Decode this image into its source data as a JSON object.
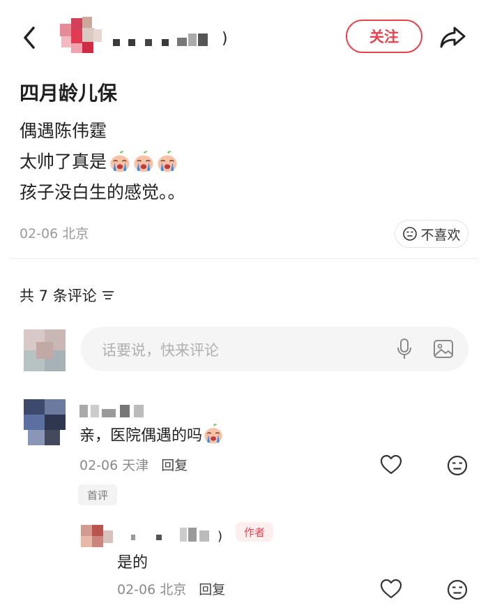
{
  "colors": {
    "accent": "#e6434f",
    "muted": "#9a9a9a",
    "surface": "#f5f5f5"
  },
  "header": {
    "follow_label": "关注",
    "icons": [
      "back-icon",
      "share-icon"
    ]
  },
  "post": {
    "title": "四月龄儿保",
    "lines": [
      "偶遇陈伟霆",
      "太帅了真是",
      "孩子没白生的感觉。。"
    ],
    "meta": "02-06 北京",
    "dislike_label": "不喜欢"
  },
  "comments": {
    "header": "共 7 条评论",
    "input_placeholder": "话要说，快来评论",
    "items": [
      {
        "text": "亲，医院偶遇的吗",
        "date_location": "02-06 天津",
        "reply_label": "回复",
        "badge": "首评",
        "reply": {
          "badge": "作者",
          "text": "是的",
          "date_location": "02-06 北京",
          "reply_label": "回复"
        }
      }
    ]
  }
}
